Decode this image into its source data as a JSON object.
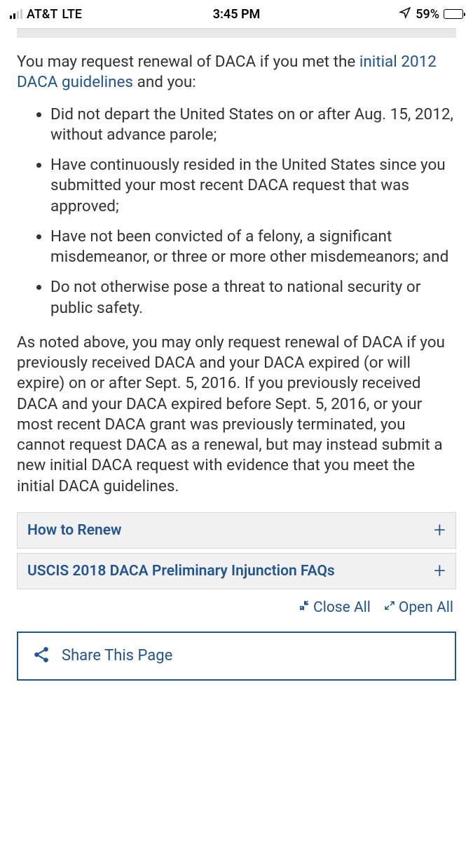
{
  "status": {
    "carrier": "AT&T",
    "network": "LTE",
    "time": "3:45 PM",
    "battery_pct": "59%"
  },
  "intro": {
    "prefix": "You may request renewal of DACA if you met the ",
    "link": "initial 2012 DACA guidelines",
    "suffix": " and you:"
  },
  "bullets": [
    "Did not depart the United States on or after Aug. 15, 2012, without advance parole;",
    "Have continuously resided in the United States since you submitted your most recent DACA request that was approved;",
    "Have not been convicted of a felony, a significant misdemeanor, or three or more other misdemeanors; and",
    "Do not otherwise pose a threat to national security or public safety."
  ],
  "paragraph": "As noted above, you may only request renewal of DACA if you previously received DACA and your DACA expired (or will expire) on or after Sept. 5, 2016. If you previously received DACA and your DACA expired before Sept. 5, 2016, or your most recent DACA grant was previously terminated, you cannot request DACA as a renewal, but may instead submit a new initial DACA request with evidence that you meet the initial DACA guidelines.",
  "accordions": {
    "how_to_renew": "How to Renew",
    "faqs": "USCIS 2018 DACA Preliminary Injunction FAQs"
  },
  "toggles": {
    "close_all": "Close All",
    "open_all": "Open All"
  },
  "share": {
    "label": "Share This Page"
  }
}
